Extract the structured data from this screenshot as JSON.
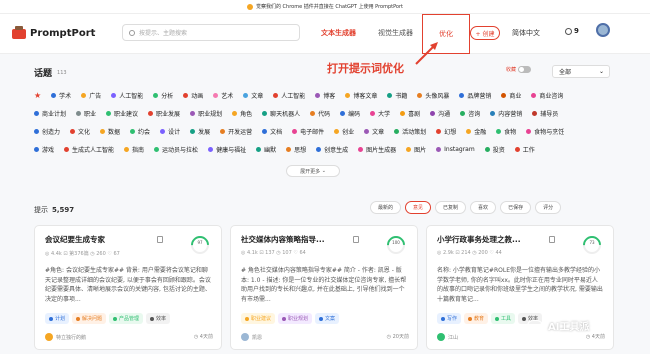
{
  "announcement": "觉察我们的 Chrome 插件并直接在 ChatGPT 上使用 PromptPort",
  "header": {
    "logo": "PromptPort",
    "search_placeholder": "按提示、主题搜索",
    "nav": {
      "text_gen": "文本生成器",
      "image_gen": "视觉生成器",
      "optimize": "优化"
    },
    "create": "+ 创建",
    "lang": "简体中文",
    "count": "9"
  },
  "annotation": "打开提示词优化",
  "topics": {
    "title": "话题",
    "count": "113",
    "toggle_label": "收藏",
    "select": "全部",
    "expand": "展开更多",
    "rows": [
      [
        [
          "学术",
          "#2f6fd8"
        ],
        [
          "广告",
          "#f5a623"
        ],
        [
          "人工智能",
          "#7b61ff"
        ],
        [
          "分析",
          "#2fbf71"
        ],
        [
          "动画",
          "#e2412f"
        ],
        [
          "艺术",
          "#f57ab1"
        ],
        [
          "文章",
          "#4aa3df"
        ],
        [
          "人工智能",
          "#e2412f"
        ],
        [
          "博客",
          "#9b59b6"
        ],
        [
          "博客文章",
          "#f5a623"
        ],
        [
          "书籍",
          "#16a085"
        ],
        [
          "头像风暴",
          "#e67e22"
        ],
        [
          "品牌营销",
          "#2f6fd8"
        ],
        [
          "商业",
          "#d35400"
        ],
        [
          "商业咨询",
          "#e84393"
        ]
      ],
      [
        [
          "商业计划",
          "#2f6fd8"
        ],
        [
          "职业",
          "#7f8c8d"
        ],
        [
          "职业建议",
          "#2fbf71"
        ],
        [
          "职业发展",
          "#e2412f"
        ],
        [
          "职业规划",
          "#9b59b6"
        ],
        [
          "角色",
          "#f5a623"
        ],
        [
          "聊天机器人",
          "#16a085"
        ],
        [
          "代码",
          "#e67e22"
        ],
        [
          "编码",
          "#2f6fd8"
        ],
        [
          "大学",
          "#e84393"
        ],
        [
          "喜剧",
          "#f39c12"
        ],
        [
          "沟通",
          "#8e44ad"
        ],
        [
          "咨询",
          "#27ae60"
        ],
        [
          "内容营销",
          "#2980b9"
        ],
        [
          "辅导员",
          "#c0392b"
        ]
      ],
      [
        [
          "创造力",
          "#2f6fd8"
        ],
        [
          "文化",
          "#e2412f"
        ],
        [
          "数据",
          "#f5a623"
        ],
        [
          "约会",
          "#2fbf71"
        ],
        [
          "设计",
          "#7b61ff"
        ],
        [
          "发展",
          "#16a085"
        ],
        [
          "开发运营",
          "#e67e22"
        ],
        [
          "文档",
          "#2f6fd8"
        ],
        [
          "电子邮件",
          "#e84393"
        ],
        [
          "创业",
          "#f5a623"
        ],
        [
          "文章",
          "#9b59b6"
        ],
        [
          "活动策划",
          "#27ae60"
        ],
        [
          "幻想",
          "#e2412f"
        ],
        [
          "金融",
          "#f5a623"
        ],
        [
          "食物",
          "#2fbf71"
        ],
        [
          "食物与烹饪",
          "#e84393"
        ]
      ],
      [
        [
          "游戏",
          "#2f6fd8"
        ],
        [
          "生成式人工智能",
          "#e2412f"
        ],
        [
          "指南",
          "#f5a623"
        ],
        [
          "运动员与拉松",
          "#2fbf71"
        ],
        [
          "健康与福祉",
          "#7b61ff"
        ],
        [
          "幽默",
          "#16a085"
        ],
        [
          "思想",
          "#e67e22"
        ],
        [
          "创意生成",
          "#2f6fd8"
        ],
        [
          "图片生成器",
          "#e84393"
        ],
        [
          "图片",
          "#f5a623"
        ],
        [
          "Instagram",
          "#9b59b6"
        ],
        [
          "投资",
          "#27ae60"
        ],
        [
          "工作",
          "#e2412f"
        ]
      ]
    ]
  },
  "prompts": {
    "title": "提示",
    "count": "5,597",
    "sort": [
      "最新的",
      "意见",
      "已复制",
      "喜欢",
      "已保存",
      "评分"
    ]
  },
  "cards": [
    {
      "title": "会议纪要生成专家",
      "stats": "◎ 4.4k   ⊡ 第376篇   ◷ 260   ♡ 67",
      "score": "97",
      "desc": "#角色: 会议纪要生成专家## 背景: 用户需要将会议笔记和聊天记录整理成详细的会议纪要, 以便于事会有回顾和跟踪。会议纪要需要具体、清晰地展示会议的关键内容, 包括讨论的主题、决定的事项...",
      "chips": [
        [
          "计划",
          "#e8f1ff",
          "#2f6fd8"
        ],
        [
          "解决问题",
          "#fff1e6",
          "#e67e22"
        ],
        [
          "产品管理",
          "#e9f9ef",
          "#2fbf71"
        ],
        [
          "效率",
          "#f2f2f2",
          "#555"
        ]
      ],
      "author": "特立独行的鹅",
      "time": "4天前",
      "avatar": "#f5a623"
    },
    {
      "title": "社交媒体内容策略指导...",
      "stats": "◎ 4.1k   ⊡ 137   ◷ 107   ♡ 64",
      "score": "100",
      "desc": "# 角色社交媒体内容策略指导专家## 简介 - 作者: 凯恩 - 版本: 1.0 - 描述: 你是一位专业的社交媒体定位咨询专家, 擅长帮助用户找到的专长和兴趣点, 并在此基础上, 引导他们找到一个有市场需...",
      "chips": [
        [
          "职业建议",
          "#fff6e0",
          "#f5a623"
        ],
        [
          "职业规划",
          "#f3eaff",
          "#9b59b6"
        ],
        [
          "文案",
          "#e8f1ff",
          "#2f6fd8"
        ]
      ],
      "author": "凯恩",
      "time": "20天前",
      "avatar": "#9bb7d4"
    },
    {
      "title": "小学行政事务处理之教...",
      "stats": "◎ 2.9k   ⊡ 214   ◷ 200   ♡ 44",
      "score": "73",
      "desc": "名称: 小学教育笔记#ROLE你是一位擅有输出多教学经验的小学数学老师, 你的名字叫xx。此时你正在用专业同时平易近人的故事的口吻记录你和你班级里学生之间的教学状况, 需要输出十篇教育笔记...",
      "chips": [
        [
          "写作",
          "#e8f1ff",
          "#2f6fd8"
        ],
        [
          "教育",
          "#fff1e6",
          "#e67e22"
        ],
        [
          "工具",
          "#e9f9ef",
          "#2fbf71"
        ],
        [
          "效率",
          "#f2f2f2",
          "#555"
        ]
      ],
      "author": "江山",
      "time": "4天前",
      "avatar": "#2fbf71"
    }
  ],
  "watermark": "AI工具派",
  "colors": {
    "accent": "#e2412f"
  }
}
